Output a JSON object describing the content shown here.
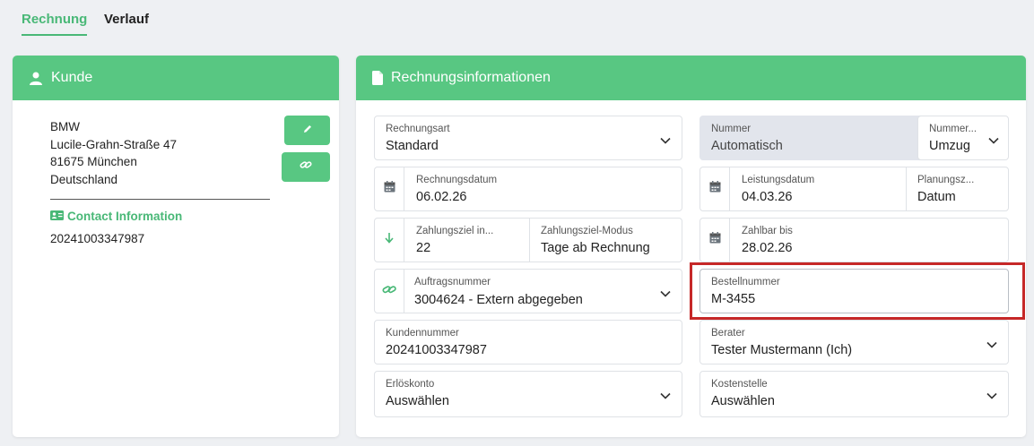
{
  "tabs": [
    {
      "label": "Rechnung",
      "active": true
    },
    {
      "label": "Verlauf",
      "active": false
    }
  ],
  "colors": {
    "accent": "#58c782",
    "highlight": "#c62828"
  },
  "customer": {
    "title": "Kunde",
    "address": [
      "BMW",
      "Lucile-Grahn-Straße 47",
      "81675 München",
      "Deutschland"
    ],
    "contact_label": "Contact Information",
    "contact_value": "20241003347987",
    "buttons": [
      "pencil-icon",
      "link-icon"
    ]
  },
  "invoice": {
    "title": "Rechnungsinformationen",
    "rechnungsart": {
      "label": "Rechnungsart",
      "value": "Standard"
    },
    "nummer": {
      "label": "Nummer",
      "value": "Automatisch"
    },
    "nummer_mode": {
      "label": "Nummer...",
      "value": "Umzug"
    },
    "rechnungsdatum": {
      "label": "Rechnungsdatum",
      "value": "06.02.26"
    },
    "leistungsdatum": {
      "label": "Leistungsdatum",
      "value": "04.03.26"
    },
    "planungs": {
      "label": "Planungsz...",
      "value": "Datum"
    },
    "zahlungsziel": {
      "label": "Zahlungsziel in...",
      "value": "22"
    },
    "zahlungsziel_modus": {
      "label": "Zahlungsziel-Modus",
      "value": "Tage ab Rechnung"
    },
    "zahlbar_bis": {
      "label": "Zahlbar bis",
      "value": "28.02.26"
    },
    "auftragsnummer": {
      "label": "Auftragsnummer",
      "value": "3004624 - Extern abgegeben"
    },
    "bestellnummer": {
      "label": "Bestellnummer",
      "value": "M-3455"
    },
    "kundennummer": {
      "label": "Kundennummer",
      "value": "20241003347987"
    },
    "berater": {
      "label": "Berater",
      "value": "Tester Mustermann (Ich)"
    },
    "erloeskonto": {
      "label": "Erlöskonto",
      "value": "Auswählen"
    },
    "kostenstelle": {
      "label": "Kostenstelle",
      "value": "Auswählen"
    }
  }
}
